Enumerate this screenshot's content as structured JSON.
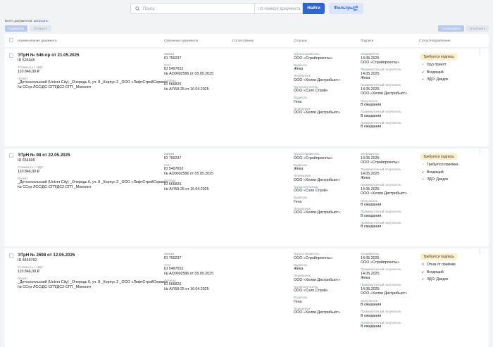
{
  "toolbar": {
    "search_placeholder": "Поиск",
    "number_placeholder": "По номеру документа",
    "find_label": "Найти",
    "filters_label": "Фильтры",
    "all_docs_label": "Всего документов:",
    "load_link": "Загрузить",
    "sign_label": "Подписать",
    "send_label": "Отказать",
    "approve_label": "Согласовать",
    "reject_label": "Отклонить"
  },
  "headers": {
    "name": "Наименование документа",
    "linked": "Связанные документы",
    "approval": "Согласование",
    "parties": "Стороны",
    "signatures": "Подписи",
    "status": "Статус/Направление"
  },
  "docs": [
    {
      "title": "ЭТрН № 546-пр от 21.05.2025",
      "id": "ID 526945",
      "cost_label": "Стоимость с НДС",
      "cost": "110 846,00 ₽",
      "project_label": "Проект",
      "project1": "_Детскосельский (Univer City) _Очередь 6, уч. 8 _Корпус 2 _ООО «ЛифтСтройСервис»",
      "project2": "№ ССтр-ЛСС/ДС-СГП/ДС2-СГП _Монолит",
      "req_label": "Заявка",
      "req": "ID 759237",
      "inv_label": "Счет",
      "inv1": "ID 5497652",
      "inv2": "№ АО0002586 от 05.05.2025",
      "contract_label": "Договор",
      "contract1": "ID 566826",
      "contract2": "№ АУ/59-25 от 16.04.2025",
      "shipper_label": "Грузоотправитель",
      "shipper": "ООО «Стройпроекты»",
      "driver1_label": "Водитель",
      "driver1": "Жека",
      "carrier1_label": "Перевозчик",
      "carrier1": "ООО «Хелпи Дистрибьют»",
      "consignee_label": "Грузополучатель",
      "consignee": "ООО «Сэлп Строй»",
      "driver2_label": "Водитель",
      "driver2": "Гена",
      "carrier2_label": "Перевозчик",
      "carrier2": "ООО «Хелпи Дистрибьют»",
      "sender_label": "Отправитель",
      "sender_date": "14.05.2025",
      "sender_org": "ООО «Стройпроекты»",
      "int1_label": "Промежуточный получатель",
      "int1_date": "14.05.2025",
      "int1_who": "Жека",
      "int2_label": "Промежуточный получатель",
      "int2_date": "14.05.2025",
      "int2_who": "ООО «Хелпи Дистрибьют»",
      "recv_label": "Получатель",
      "recv_state": "В ожидании",
      "int3_label": "Промежуточный получатель",
      "int3_state": "В ожидании",
      "int4_label": "Промежуточный получатель",
      "int4_state": "В ожидании",
      "badge": "Требуется подпись",
      "st1": "Груз принят",
      "st1_icon": "✓",
      "st1_color": "#2e9e4f",
      "st2": "Входящий",
      "st3": "ЭДО: Диадок"
    },
    {
      "title": "ЭТрН № 98 от 22.05.2025",
      "id": "ID 654698",
      "cost_label": "Стоимость с НДС",
      "cost": "110 846,00 ₽",
      "project_label": "Проект",
      "project1": "_Детскосельский (Univer City) _Очередь 6, уч. 8 _Корпус 2 _ООО «ЛифтСтройСервис»",
      "project2": "№ ССтр-ЛСС/ДС-СГП/ДС2-СГП _Монолит",
      "req_label": "Заявка",
      "req": "ID 759237",
      "inv_label": "Счет",
      "inv1": "ID 5497652",
      "inv2": "№ АО0002586 от 05.05.2025",
      "contract_label": "Договор",
      "contract1": "ID 566826",
      "contract2": "№ АУ/59-25 от 16.04.2025",
      "shipper_label": "Грузоотправитель",
      "shipper": "ООО «Стройпроекты»",
      "driver1_label": "Водитель",
      "driver1": "Жека",
      "carrier1_label": "Перевозчик",
      "carrier1": "ООО «Хелпи Дистрибьют»",
      "consignee_label": "Грузополучатель",
      "consignee": "ООО «Сэлп Строй»",
      "driver2_label": "Водитель",
      "driver2": "Гена",
      "carrier2_label": "Перевозчик",
      "carrier2": "ООО «Хелпи Дистрибьют»",
      "sender_label": "Отправитель",
      "sender_date": "14.05.2025",
      "sender_org": "ООО «Стройпроекты»",
      "int1_label": "Промежуточный получатель",
      "int1_date": "14.05.2025",
      "int1_who": "Жека",
      "int2_label": "Промежуточный получатель",
      "int2_date": "14.05.2025",
      "int2_who": "ООО «Хелпи Дистрибьют»",
      "recv_label": "Получатель",
      "recv_state": "В ожидании",
      "int3_label": "Промежуточный получатель",
      "int3_state": "В ожидании",
      "int4_label": "Промежуточный получатель",
      "int4_state": "В ожидании",
      "badge": "Требуется подпись",
      "st1": "Требуется приёмка",
      "st1_icon": "◔",
      "st1_color": "#e0a21a",
      "st2": "Входящий",
      "st3": "ЭДО: Диадок"
    },
    {
      "title": "ЭТрН № 2698 от 12.05.2025",
      "id": "ID 8469782",
      "cost_label": "Стоимость с НДС",
      "cost": "110 846,00 ₽",
      "project_label": "Проект",
      "project1": "_Детскосельский (Univer City) _Очередь 6, уч. 8 _Корпус 2 _ООО «ЛифтСтройСервис»",
      "project2": "№ ССтр-ЛСС/ДС-СГП/ДС2-СГП _Монолит",
      "req_label": "Заявка",
      "req": "ID 759237",
      "inv_label": "Счет",
      "inv1": "ID 5497652",
      "inv2": "№ АО0002586 от 05.05.2025",
      "contract_label": "Договор",
      "contract1": "ID 566826",
      "contract2": "№ АУ/59-25 от 16.04.2025",
      "shipper_label": "Грузоотправитель",
      "shipper": "ООО «Стройпроекты»",
      "driver1_label": "Водитель",
      "driver1": "Жека",
      "carrier1_label": "Перевозчик",
      "carrier1": "ООО «Хелпи Дистрибьют»",
      "consignee_label": "Грузополучатель",
      "consignee": "ООО «Сэлп Строй»",
      "driver2_label": "Водитель",
      "driver2": "Гена",
      "carrier2_label": "Перевозчик",
      "carrier2": "ООО «Хелпи Дистрибьют»",
      "sender_label": "Отправитель",
      "sender_date": "14.05.2025",
      "sender_org": "ООО «Стройпроекты»",
      "int1_label": "Промежуточный получатель",
      "int1_date": "14.05.2025",
      "int1_who": "Жека",
      "int2_label": "Промежуточный получатель",
      "int2_date": "14.05.2025",
      "int2_who": "ООО «Хелпи Дистрибьют»",
      "recv_label": "Получатель",
      "recv_state": "В ожидании",
      "int3_label": "Промежуточный получатель",
      "int3_state": "В ожидании",
      "int4_label": "Промежуточный получатель",
      "int4_state": "В ожидании",
      "badge": "Требуется подпись",
      "st1": "Отказ от приёмки",
      "st1_icon": "✕",
      "st1_color": "#d93a3a",
      "st2": "Входящий",
      "st3": "ЭДО: Диадок"
    }
  ]
}
